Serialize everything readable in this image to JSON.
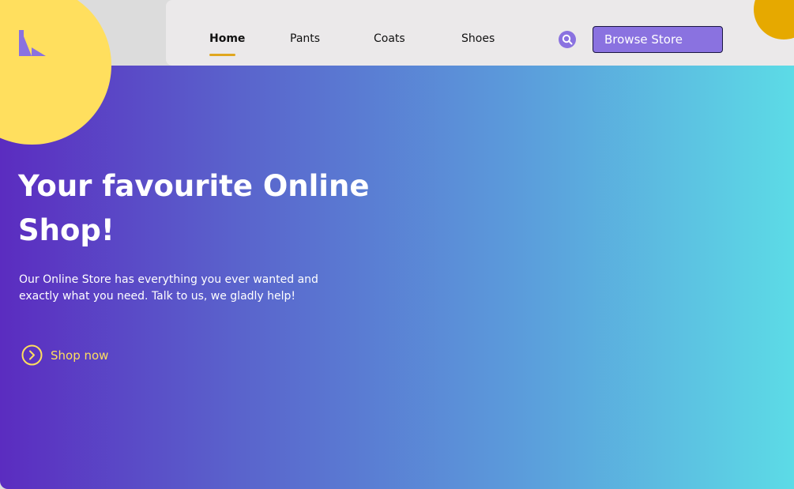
{
  "nav": {
    "links": [
      {
        "label": "Home",
        "active": true
      },
      {
        "label": "Pants",
        "active": false
      },
      {
        "label": "Coats",
        "active": false
      },
      {
        "label": "Shoes",
        "active": false
      }
    ],
    "search_icon": "search-icon",
    "browse_label": "Browse Store"
  },
  "hero": {
    "title": "Your favourite Online Shop!",
    "description": "Our Online Store has everything you ever wanted and exactly what you need. Talk to us, we gladly help!",
    "cta_label": "Shop now",
    "cta_icon": "chevron-right-circle-icon"
  },
  "colors": {
    "accent_yellow": "#ffdf5e",
    "accent_orange": "#e6a900",
    "accent_purple": "#8a72e0",
    "gradient_start": "#5b2cc0",
    "gradient_end": "#5cdbe6",
    "nav_bg": "#ebe9ea"
  }
}
